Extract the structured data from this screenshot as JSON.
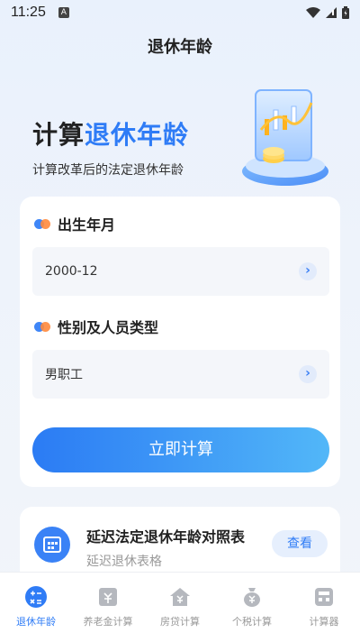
{
  "status_bar": {
    "time": "11:25",
    "badge": "A"
  },
  "header": {
    "title": "退休年龄"
  },
  "hero": {
    "title_plain": "计算",
    "title_accent": "退休年龄",
    "subtitle": "计算改革后的法定退休年龄"
  },
  "form": {
    "birth_label": "出生年月",
    "birth_value": "2000-12",
    "type_label": "性别及人员类型",
    "type_value": "男职工",
    "submit_label": "立即计算"
  },
  "table_card": {
    "title": "延迟法定退休年龄对照表",
    "subtitle": "延迟退休表格",
    "button": "查看"
  },
  "tabs": [
    {
      "label": "退休年龄",
      "icon": "calculator-icon",
      "active": true
    },
    {
      "label": "养老金计算",
      "icon": "pension-icon",
      "active": false
    },
    {
      "label": "房贷计算",
      "icon": "house-icon",
      "active": false
    },
    {
      "label": "个税计算",
      "icon": "money-bag-icon",
      "active": false
    },
    {
      "label": "计算器",
      "icon": "calculator-grid-icon",
      "active": false
    }
  ],
  "colors": {
    "accent": "#2f7cf6",
    "accent_light": "#52b7f8",
    "dot_orange": "#ff8a3d",
    "inactive": "#999999"
  }
}
